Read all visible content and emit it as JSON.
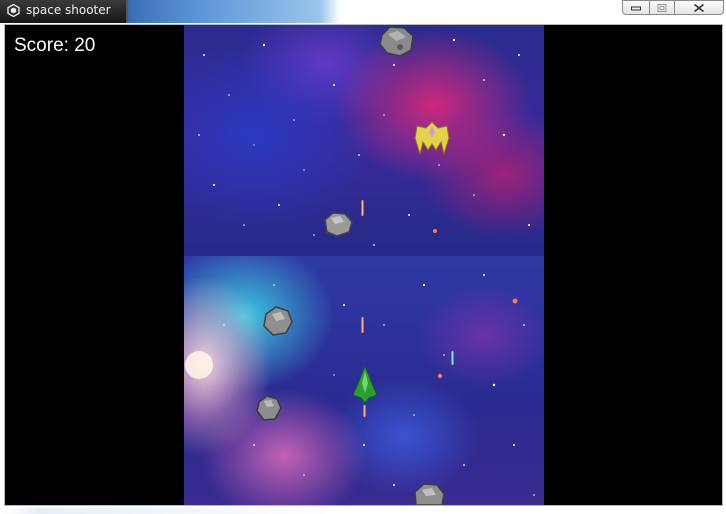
{
  "window": {
    "title": "space shooter",
    "icon": "unity-icon",
    "controls": {
      "minimize": "minimize-icon",
      "maximize": "maximize-icon",
      "close": "close-icon"
    }
  },
  "hud": {
    "score_label": "Score: 20",
    "score_value": 20
  },
  "game": {
    "player": {
      "type": "player-ship",
      "color": "#2e9c34"
    },
    "enemies": [
      {
        "type": "enemy-ship",
        "color": "#e3d34a"
      }
    ],
    "asteroids": [
      {
        "type": "asteroid"
      },
      {
        "type": "asteroid"
      },
      {
        "type": "asteroid"
      },
      {
        "type": "asteroid"
      },
      {
        "type": "asteroid"
      }
    ],
    "projectiles": [
      {
        "type": "laser-bolt",
        "color": "#ffb070"
      },
      {
        "type": "laser-bolt",
        "color": "#ffb070"
      },
      {
        "type": "laser-bolt",
        "color": "#ffb070"
      },
      {
        "type": "laser-bolt",
        "color": "#7fe0ff"
      }
    ]
  },
  "colors": {
    "letterbox": "#000000",
    "score_text": "#ffffff"
  }
}
